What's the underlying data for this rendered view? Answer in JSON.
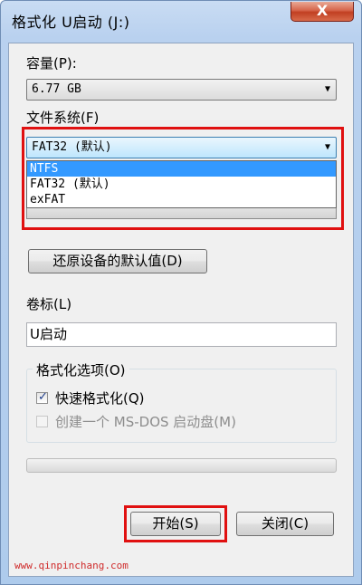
{
  "window": {
    "title": "格式化 U启动 (J:)",
    "close_label": "X"
  },
  "capacity": {
    "label": "容量(P):",
    "value": "6.77 GB"
  },
  "filesystem": {
    "label": "文件系统(F)",
    "value": "FAT32 (默认)",
    "options": [
      "NTFS",
      "FAT32 (默认)",
      "exFAT"
    ],
    "selected_index": 0
  },
  "restore_defaults_label": "还原设备的默认值(D)",
  "volume": {
    "label": "卷标(L)",
    "value": "U启动"
  },
  "format_options": {
    "label": "格式化选项(O)",
    "quick_format": {
      "label": "快速格式化(Q)",
      "checked": true
    },
    "ms_dos": {
      "label": "创建一个 MS-DOS 启动盘(M)",
      "checked": false,
      "enabled": false
    }
  },
  "progress_value": 0,
  "buttons": {
    "start": "开始(S)",
    "close": "关闭(C)"
  },
  "watermark": "www.qinpinchang.com",
  "colors": {
    "highlight": "#e01010",
    "selection": "#3399ff"
  }
}
